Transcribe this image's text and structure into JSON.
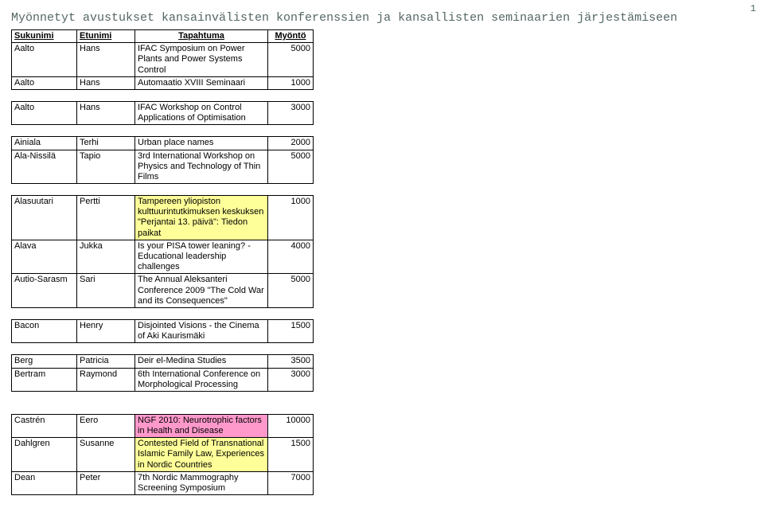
{
  "page_number": "1",
  "title": "Myönnetyt avustukset kansainvälisten konferenssien ja kansallisten seminaarien järjestämiseen",
  "headers": {
    "surname": "Sukunimi",
    "firstname": "Etunimi",
    "event": "Tapahtuma",
    "amount": "Myöntö"
  },
  "rows": [
    {
      "surname": "Aalto",
      "first": "Hans",
      "event": "IFAC Symposium on Power Plants and Power Systems Control",
      "amount": "5000",
      "style": ""
    },
    {
      "surname": "Aalto",
      "first": "Hans",
      "event": "Automaatio XVIII Seminaari",
      "amount": "1000",
      "style": ""
    },
    {
      "spacer": true
    },
    {
      "surname": "Aalto",
      "first": "Hans",
      "event": "IFAC Workshop on Control Applications of Optimisation",
      "amount": "3000",
      "style": ""
    },
    {
      "spacer": true
    },
    {
      "surname": "Ainiala",
      "first": "Terhi",
      "event": "Urban place names",
      "amount": "2000",
      "style": ""
    },
    {
      "surname": "Ala-Nissilä",
      "first": "Tapio",
      "event": "3rd International Workshop on Physics and Technology of Thin Films",
      "amount": "5000",
      "style": ""
    },
    {
      "spacer": true
    },
    {
      "surname": "Alasuutari",
      "first": "Pertti",
      "event": "Tampereen yliopiston kulttuurintutkimuksen keskuksen \"Perjantai 13. päivä\": Tiedon paikat",
      "amount": "1000",
      "style": "hl-yellow"
    },
    {
      "surname": "Alava",
      "first": "Jukka",
      "event": "Is your PISA tower leaning? - Educational leadership challenges",
      "amount": "4000",
      "style": ""
    },
    {
      "surname": "Autio-Sarasm",
      "first": "Sari",
      "event": "The Annual Aleksanteri Conference 2009 \"The Cold War and its Consequences\"",
      "amount": "5000",
      "style": ""
    },
    {
      "spacer": true
    },
    {
      "surname": "Bacon",
      "first": "Henry",
      "event": "Disjointed Visions - the Cinema of Aki Kaurismäki",
      "amount": "1500",
      "style": ""
    },
    {
      "spacer": true
    },
    {
      "surname": "Berg",
      "first": "Patricia",
      "event": "Deir el-Medina Studies",
      "amount": "3500",
      "style": ""
    },
    {
      "surname": "Bertram",
      "first": "Raymond",
      "event": "6th International Conference on Morphological Processing",
      "amount": "3000",
      "style": ""
    },
    {
      "bigspacer": true
    },
    {
      "surname": "Castrén",
      "first": "Eero",
      "event": "NGF 2010: Neurotrophic factors in Health and Disease",
      "amount": "10000",
      "style": "hl-pink"
    },
    {
      "surname": "Dahlgren",
      "first": "Susanne",
      "event": "Contested Field of Transnational Islamic Family Law, Experiences in Nordic Countries",
      "amount": "1500",
      "style": "hl-yellow"
    },
    {
      "surname": "Dean",
      "first": "Peter",
      "event": "7th Nordic Mammography Screening Symposium",
      "amount": "7000",
      "style": ""
    }
  ]
}
